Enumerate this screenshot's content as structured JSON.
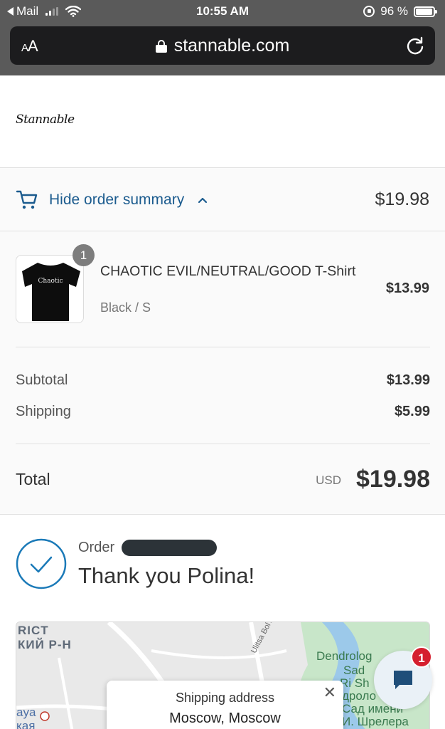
{
  "status_bar": {
    "back_label": "Mail",
    "time": "10:55 AM",
    "battery": "96 %",
    "battery_level": 0.96
  },
  "address_bar": {
    "text_size_label": "AA",
    "url": "stannable.com"
  },
  "site": {
    "logo_text": "Stannable"
  },
  "order_summary": {
    "toggle_label": "Hide order summary",
    "toggle_total": "$19.98",
    "product": {
      "quantity": "1",
      "name": "CHAOTIC EVIL/NEUTRAL/GOOD T-Shirt",
      "variant": "Black / S",
      "price": "$13.99",
      "shirt_print": "Chaotic"
    },
    "subtotal_label": "Subtotal",
    "subtotal_value": "$13.99",
    "shipping_label": "Shipping",
    "shipping_value": "$5.99",
    "total_label": "Total",
    "total_currency": "USD",
    "total_value": "$19.98"
  },
  "confirmation": {
    "order_label": "Order",
    "title": "Thank you Polina!"
  },
  "map": {
    "district_label_1": "RICT",
    "district_label_2": "КИЙ Р-Н",
    "street_label": "Ulitsa Bol'shay",
    "park_label_1": "Dendrolog",
    "park_label_2": "Sad",
    "park_label_3": "Ri Sh",
    "park_label_4": "дроло",
    "park_label_5": "Сад имени",
    "park_label_6": "И. Шрелера",
    "left_label_1": "aya",
    "left_label_2": "кая",
    "shipping_title": "Shipping address",
    "shipping_value": "Moscow, Moscow"
  },
  "chat": {
    "badge_count": "1"
  },
  "colors": {
    "link": "#1b5b8e",
    "badge": "#d51f2e",
    "redaction": "#2c3338"
  }
}
